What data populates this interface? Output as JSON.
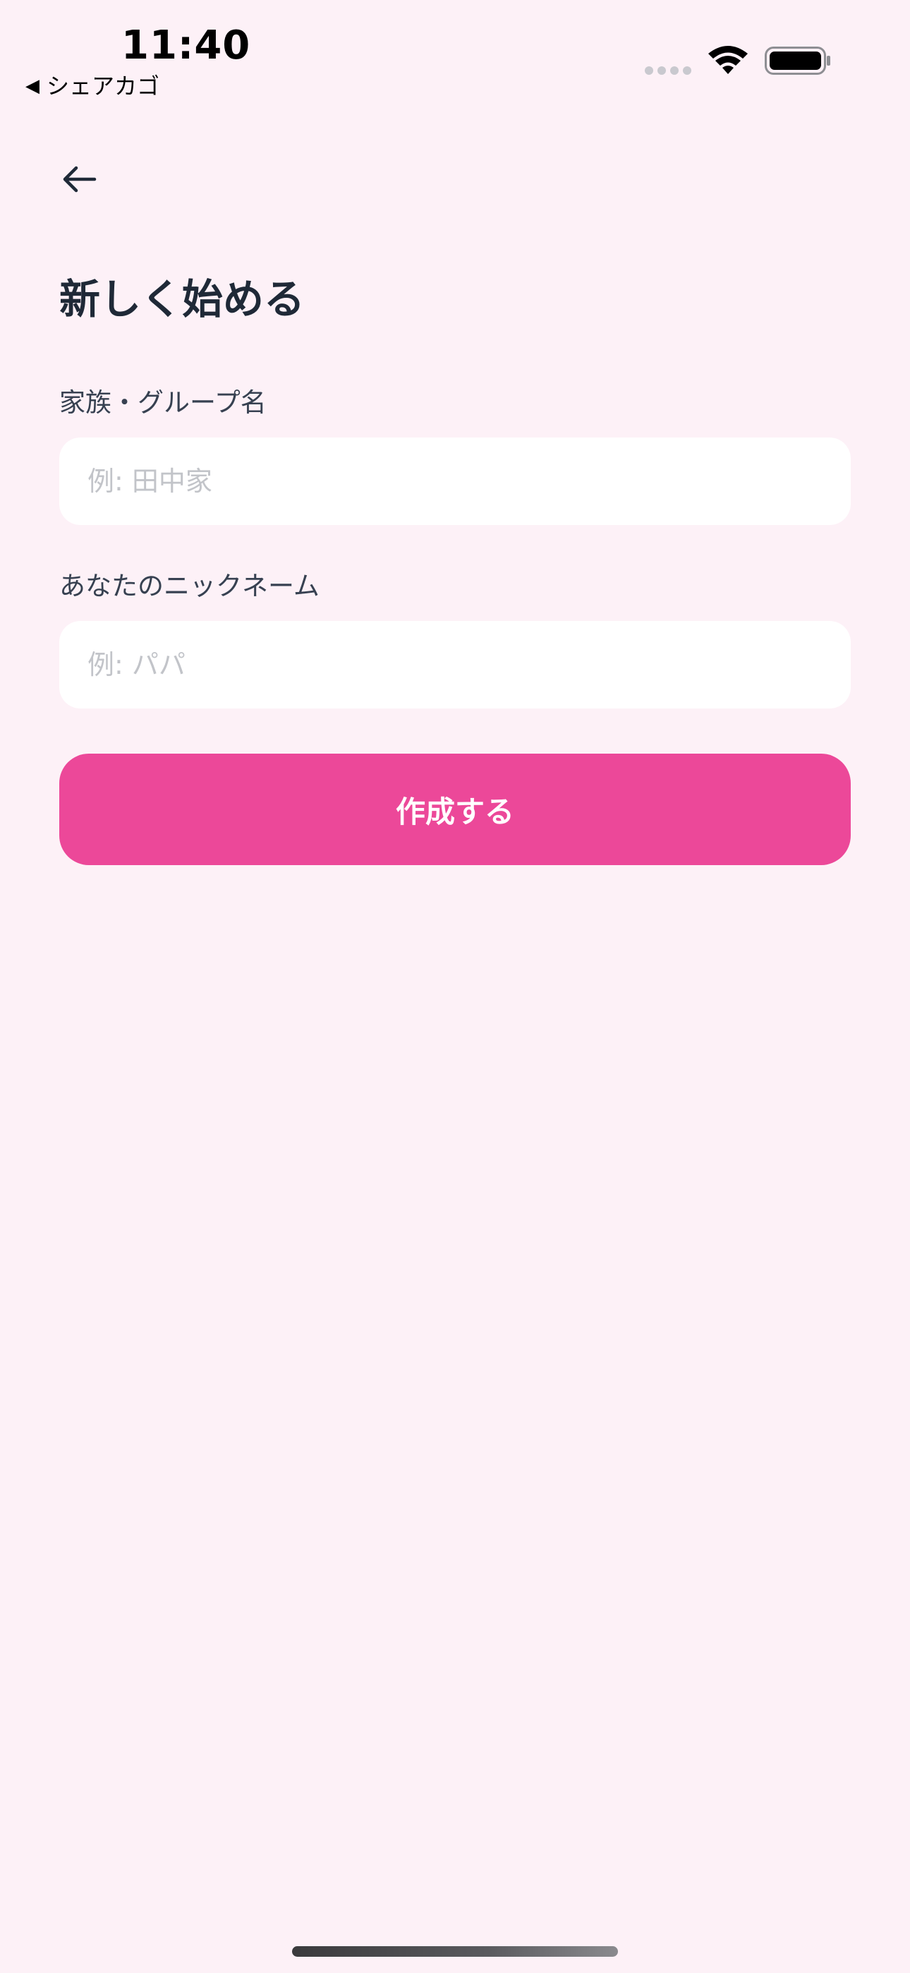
{
  "status_bar": {
    "time": "11:40",
    "back_app_arrow": "◀",
    "back_app_label": "シェアカゴ",
    "icons": [
      "signal-dots-icon",
      "wifi-icon",
      "battery-icon"
    ]
  },
  "nav": {
    "back_icon": "arrow-left-icon"
  },
  "page": {
    "title": "新しく始める"
  },
  "form": {
    "group_name_label": "家族・グループ名",
    "group_name_value": "",
    "group_name_placeholder": "例: 田中家",
    "nickname_label": "あなたのニックネーム",
    "nickname_value": "",
    "nickname_placeholder": "例: パパ",
    "submit_label": "作成する"
  },
  "colors": {
    "background": "#fdf1f7",
    "accent": "#ec4899",
    "input_background": "#ffffff",
    "title_text": "#1f2937",
    "placeholder_text": "#c2c4c9"
  }
}
